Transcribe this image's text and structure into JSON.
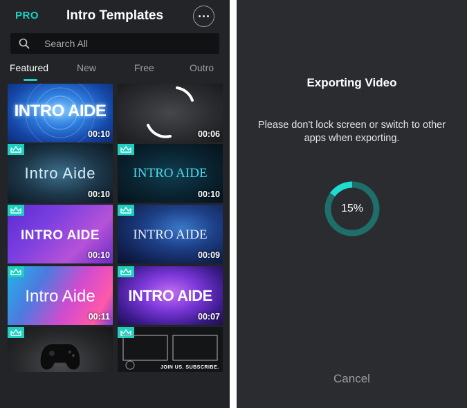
{
  "left_screen": {
    "pro_label": "PRO",
    "title": "Intro Templates",
    "more_icon": "more-dots-icon",
    "search": {
      "placeholder": "Search All",
      "icon": "search-icon"
    },
    "tabs": [
      "Featured",
      "New",
      "Free",
      "Outro"
    ],
    "active_tab": "Featured",
    "accent_color": "#19d3c5",
    "templates": [
      {
        "brand": "INTRO AIDE",
        "duration": "00:10",
        "premium": false
      },
      {
        "brand": "",
        "duration": "00:06",
        "premium": false
      },
      {
        "brand": "Intro Aide",
        "duration": "00:10",
        "premium": true
      },
      {
        "brand": "INTRO AIDE",
        "duration": "00:10",
        "premium": true
      },
      {
        "brand": "INTRO AIDE",
        "duration": "00:10",
        "premium": true
      },
      {
        "brand": "INTRO AIDE",
        "duration": "00:09",
        "premium": true
      },
      {
        "brand": "Intro Aide",
        "duration": "00:11",
        "premium": true
      },
      {
        "brand": "INTRO AIDE",
        "duration": "00:07",
        "premium": true
      },
      {
        "brand": "",
        "duration": "",
        "premium": true
      },
      {
        "brand": "JOIN US. SUBSCRIBE.",
        "duration": "",
        "premium": true
      }
    ]
  },
  "right_screen": {
    "title": "Exporting Video",
    "message": "Please don't lock screen or switch to other apps when exporting.",
    "progress_percent": 15,
    "progress_label": "15%",
    "cancel_label": "Cancel"
  }
}
